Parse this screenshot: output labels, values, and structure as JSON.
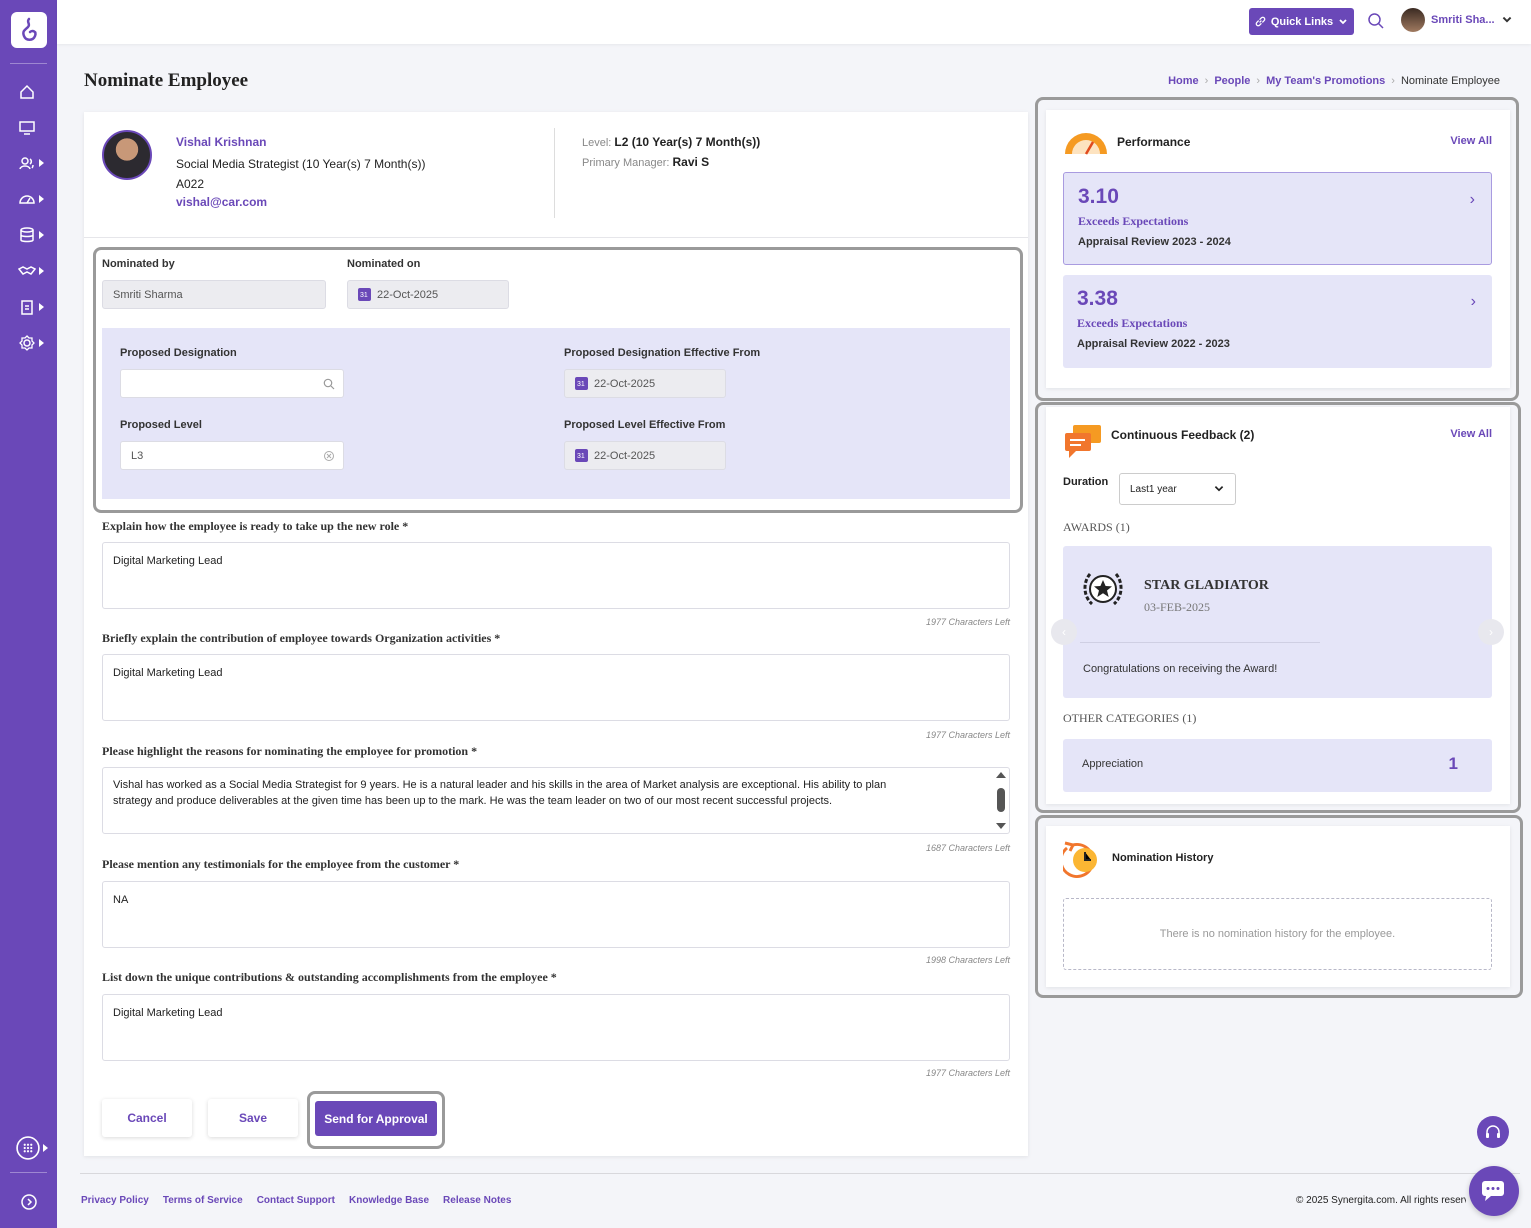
{
  "topbar": {
    "quick_links": "Quick Links",
    "user_name": "Smriti Sha..."
  },
  "page": {
    "title": "Nominate Employee",
    "breadcrumb": [
      "Home",
      "People",
      "My Team's Promotions",
      "Nominate Employee"
    ]
  },
  "employee": {
    "name": "Vishal Krishnan",
    "role": "Social Media Strategist (10 Year(s) 7 Month(s))",
    "code": "A022",
    "email": "vishal@car.com",
    "level_label": "Level:",
    "level_value": "L2 (10 Year(s) 7 Month(s))",
    "manager_label": "Primary Manager:",
    "manager_value": "Ravi S"
  },
  "nomination": {
    "nominated_by_label": "Nominated by",
    "nominated_by_value": "Smriti Sharma",
    "nominated_on_label": "Nominated on",
    "nominated_on_value": "22-Oct-2025",
    "proposed_designation_label": "Proposed Designation",
    "proposed_designation_value": "",
    "designation_effective_label": "Proposed Designation Effective From",
    "designation_effective_value": "22-Oct-2025",
    "proposed_level_label": "Proposed Level",
    "proposed_level_value": "L3",
    "level_effective_label": "Proposed Level Effective From",
    "level_effective_value": "22-Oct-2025"
  },
  "questions": [
    {
      "label": "Explain how the employee is ready to take up the new role *",
      "value": "Digital Marketing  Lead",
      "chars": "1977 Characters Left"
    },
    {
      "label": "Briefly explain the contribution of employee towards Organization activities *",
      "value": "Digital Marketing  Lead",
      "chars": "1977 Characters Left"
    },
    {
      "label": "Please highlight the reasons for nominating the employee for promotion *",
      "value": "Vishal has worked as a Social Media Strategist for 9 years. He is a natural leader and his skills in the area of Market  analysis are exceptional. His ability to plan strategy and produce deliverables at the given time has been up to the mark. He was the team leader on two of our most recent successful projects.",
      "chars": "1687 Characters Left"
    },
    {
      "label": "Please mention any testimonials for the employee from the customer *",
      "value": "NA",
      "chars": "1998 Characters Left"
    },
    {
      "label": "List down the unique contributions & outstanding accomplishments from the employee *",
      "value": "Digital Marketing  Lead",
      "chars": "1977 Characters Left"
    }
  ],
  "actions": {
    "cancel": "Cancel",
    "save": "Save",
    "send": "Send for Approval"
  },
  "performance": {
    "title": "Performance",
    "view_all": "View All",
    "cards": [
      {
        "score": "3.10",
        "rating": "Exceeds Expectations",
        "cycle": "Appraisal Review 2023 - 2024"
      },
      {
        "score": "3.38",
        "rating": "Exceeds Expectations",
        "cycle": "Appraisal Review 2022 - 2023"
      }
    ]
  },
  "feedback": {
    "title": "Continuous Feedback (2)",
    "view_all": "View All",
    "duration_label": "Duration",
    "duration_value": "Last1 year",
    "awards_caption": "AWARDS (1)",
    "award_name": "STAR GLADIATOR",
    "award_date": "03-FEB-2025",
    "award_message": "Congratulations on receiving the Award!",
    "other_caption": "OTHER CATEGORIES (1)",
    "category_name": "Appreciation",
    "category_count": "1"
  },
  "history": {
    "title": "Nomination History",
    "empty": "There is no nomination history for the employee."
  },
  "footer": {
    "links": [
      "Privacy Policy",
      "Terms of Service",
      "Contact Support",
      "Knowledge Base",
      "Release Notes"
    ],
    "copyright": "© 2025 Synergita.com. All rights reserved."
  },
  "colors": {
    "brand": "#6a48b8",
    "panel_tint": "#e5e5f8"
  }
}
